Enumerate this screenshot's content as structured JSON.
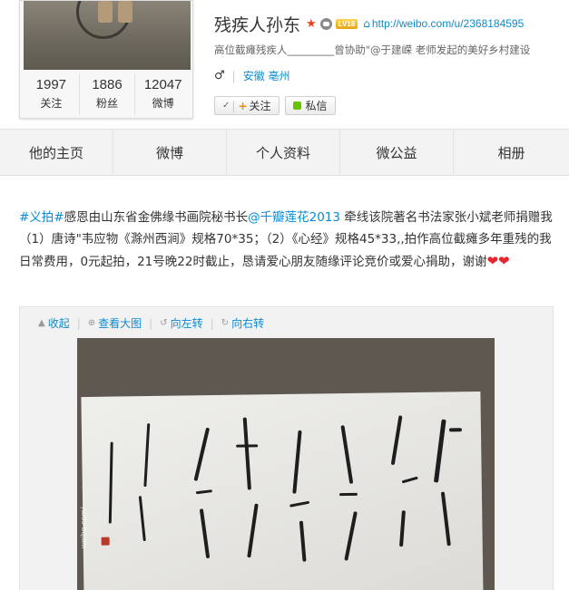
{
  "profile": {
    "name": "残疾人孙东",
    "level_badge": "LV18",
    "home_url": "http://weibo.com/u/2368184595",
    "bio": "高位截瘫残疾人_________曾协助\"@于建嵘 老师发起的美好乡村建设",
    "location": "安徽 亳州",
    "stats": [
      {
        "value": "1997",
        "label": "关注"
      },
      {
        "value": "1886",
        "label": "粉丝"
      },
      {
        "value": "12047",
        "label": "微博"
      }
    ],
    "follow_button": "关注",
    "message_button": "私信"
  },
  "nav": {
    "tabs": [
      "他的主页",
      "微博",
      "个人资料",
      "微公益",
      "相册"
    ]
  },
  "post": {
    "topic": "#义拍#",
    "text_part1": "感恩由山东省金佛缘书画院秘书长",
    "mention": "@千瓣莲花2013",
    "text_part2": " 牵线该院著名书法家张小斌老师捐赠我（1）唐诗\"韦应物《滁州西涧》规格70*35；（2）《心经》规格45*33,,拍作高位截瘫多年重残的我日常费用，0元起拍，21号晚22时截止，恳请爱心朋友随缘评论竞价或爱心捐助，谢谢",
    "hearts": "❤❤"
  },
  "media": {
    "tools": [
      "收起",
      "查看大图",
      "向左转",
      "向右转"
    ],
    "watermark": "weibo.com/"
  },
  "colors": {
    "link": "#0a8cd2",
    "accent_orange": "#f08a00",
    "message_green": "#68c200"
  }
}
